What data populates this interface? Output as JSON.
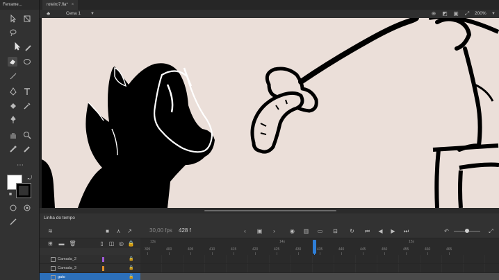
{
  "panels": {
    "tools_title": "Ferrame...",
    "timeline_title": "Linha do tempo"
  },
  "document": {
    "tab_label": "roteiro7.fla*",
    "close_glyph": "×"
  },
  "edit_bar": {
    "scene_label": "Cena 1",
    "zoom": "200%"
  },
  "timeline": {
    "fps": "30,00 fps",
    "current_frame": "428 f",
    "seconds_marks": [
      "13s",
      "14s",
      "15s"
    ],
    "frame_ticks": [
      "395",
      "400",
      "405",
      "410",
      "415",
      "420",
      "425",
      "430",
      "435",
      "440",
      "445",
      "450",
      "455",
      "460",
      "465"
    ],
    "playhead_frame": 428
  },
  "layers": [
    {
      "name": "Camada_2",
      "color": "#a05ad9",
      "selected": false
    },
    {
      "name": "Camada_3",
      "color": "#e0902a",
      "selected": false
    },
    {
      "name": "gato",
      "color": "#2c6fb9",
      "selected": true
    }
  ],
  "colors": {
    "stage_bg": "#ebdfd9",
    "stroke": "#000000",
    "fill_swatch": "#ffffff",
    "selection": "#2c6fb9"
  }
}
